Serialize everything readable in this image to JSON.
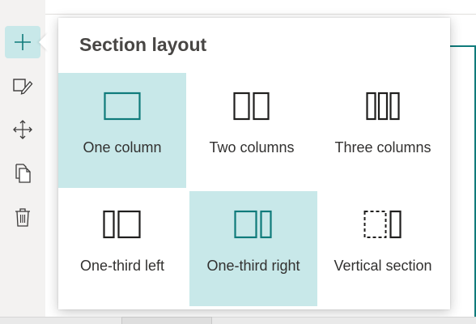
{
  "flyout": {
    "title": "Section layout",
    "options": [
      {
        "label": "One column",
        "icon": "one-column-icon",
        "selected": true
      },
      {
        "label": "Two columns",
        "icon": "two-columns-icon",
        "selected": false
      },
      {
        "label": "Three columns",
        "icon": "three-columns-icon",
        "selected": false
      },
      {
        "label": "One-third left",
        "icon": "one-third-left-icon",
        "selected": false
      },
      {
        "label": "One-third right",
        "icon": "one-third-right-icon",
        "selected": true
      },
      {
        "label": "Vertical section",
        "icon": "vertical-section-icon",
        "selected": false
      }
    ]
  },
  "toolbar": {
    "items": [
      {
        "icon": "add-icon",
        "active": true
      },
      {
        "icon": "edit-section-icon",
        "active": false
      },
      {
        "icon": "move-icon",
        "active": false
      },
      {
        "icon": "duplicate-icon",
        "active": false
      },
      {
        "icon": "delete-icon",
        "active": false
      }
    ]
  },
  "colors": {
    "accent": "#0f7b7b",
    "selected_bg": "#c8e8e9",
    "text": "#323130",
    "title": "#484644",
    "icon_dark": "#201f1e"
  }
}
